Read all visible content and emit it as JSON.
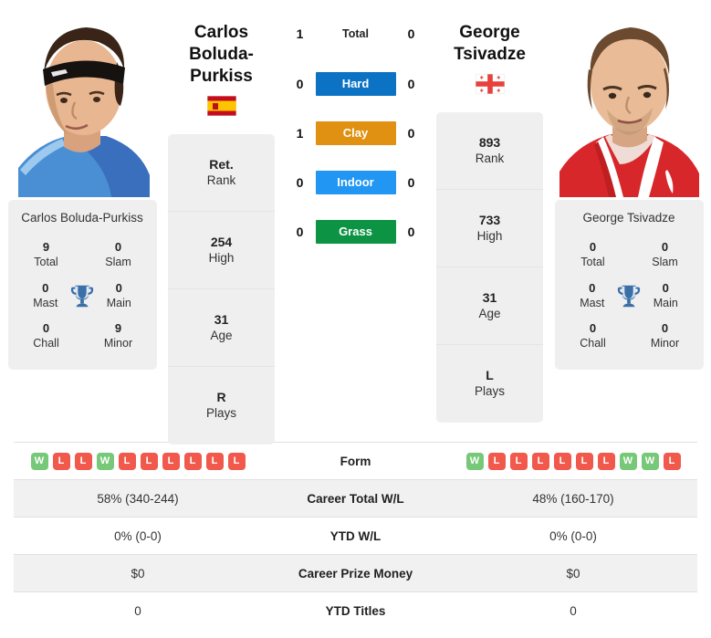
{
  "players": {
    "left": {
      "name_line1": "Carlos Boluda-",
      "name_line2": "Purkiss",
      "full_name": "Carlos Boluda-Purkiss",
      "country": "Spain",
      "flag_icon": "flag-spain",
      "photo_alt": "carlos-boluda-purkiss-photo",
      "stats": [
        {
          "value": "Ret.",
          "label": "Rank"
        },
        {
          "value": "254",
          "label": "High"
        },
        {
          "value": "31",
          "label": "Age"
        },
        {
          "value": "R",
          "label": "Plays"
        }
      ],
      "titles": {
        "total": "9",
        "total_label": "Total",
        "slam": "0",
        "slam_label": "Slam",
        "mast": "0",
        "mast_label": "Mast",
        "main": "0",
        "main_label": "Main",
        "chall": "0",
        "chall_label": "Chall",
        "minor": "9",
        "minor_label": "Minor"
      },
      "form": [
        "W",
        "L",
        "L",
        "W",
        "L",
        "L",
        "L",
        "L",
        "L",
        "L"
      ],
      "career_wl": "58% (340-244)",
      "ytd_wl": "0% (0-0)",
      "prize": "$0",
      "ytd_titles": "0"
    },
    "right": {
      "name_line1": "George",
      "name_line2": "Tsivadze",
      "full_name": "George Tsivadze",
      "country": "Georgia",
      "flag_icon": "flag-georgia",
      "photo_alt": "george-tsivadze-photo",
      "stats": [
        {
          "value": "893",
          "label": "Rank"
        },
        {
          "value": "733",
          "label": "High"
        },
        {
          "value": "31",
          "label": "Age"
        },
        {
          "value": "L",
          "label": "Plays"
        }
      ],
      "titles": {
        "total": "0",
        "total_label": "Total",
        "slam": "0",
        "slam_label": "Slam",
        "mast": "0",
        "mast_label": "Mast",
        "main": "0",
        "main_label": "Main",
        "chall": "0",
        "chall_label": "Chall",
        "minor": "0",
        "minor_label": "Minor"
      },
      "form": [
        "W",
        "L",
        "L",
        "L",
        "L",
        "L",
        "L",
        "W",
        "W",
        "L"
      ],
      "career_wl": "48% (160-170)",
      "ytd_wl": "0% (0-0)",
      "prize": "$0",
      "ytd_titles": "0"
    }
  },
  "h2h": {
    "rows": [
      {
        "label": "Total",
        "left": "1",
        "right": "0",
        "color": "none"
      },
      {
        "label": "Hard",
        "left": "0",
        "right": "0",
        "color": "#0b72c4"
      },
      {
        "label": "Clay",
        "left": "1",
        "right": "0",
        "color": "#e09111"
      },
      {
        "label": "Indoor",
        "left": "0",
        "right": "0",
        "color": "#2196f3"
      },
      {
        "label": "Grass",
        "left": "0",
        "right": "0",
        "color": "#0d9344"
      }
    ]
  },
  "comparison": {
    "rows": [
      {
        "label": "Form",
        "left": "",
        "right": "",
        "kind": "form",
        "alt": false
      },
      {
        "label": "Career Total W/L",
        "left": "58% (340-244)",
        "right": "48% (160-170)",
        "kind": "text",
        "alt": true
      },
      {
        "label": "YTD W/L",
        "left": "0% (0-0)",
        "right": "0% (0-0)",
        "kind": "text",
        "alt": false
      },
      {
        "label": "Career Prize Money",
        "left": "$0",
        "right": "$0",
        "kind": "text",
        "alt": true
      },
      {
        "label": "YTD Titles",
        "left": "0",
        "right": "0",
        "kind": "text",
        "alt": false
      }
    ]
  },
  "colors": {
    "win_badge": "#77c878",
    "loss_badge": "#f0594b",
    "trophy": "#3b6fa8",
    "card_bg": "#efefef",
    "hard": "#0b72c4",
    "clay": "#e09111",
    "indoor": "#2196f3",
    "grass": "#0d9344"
  }
}
